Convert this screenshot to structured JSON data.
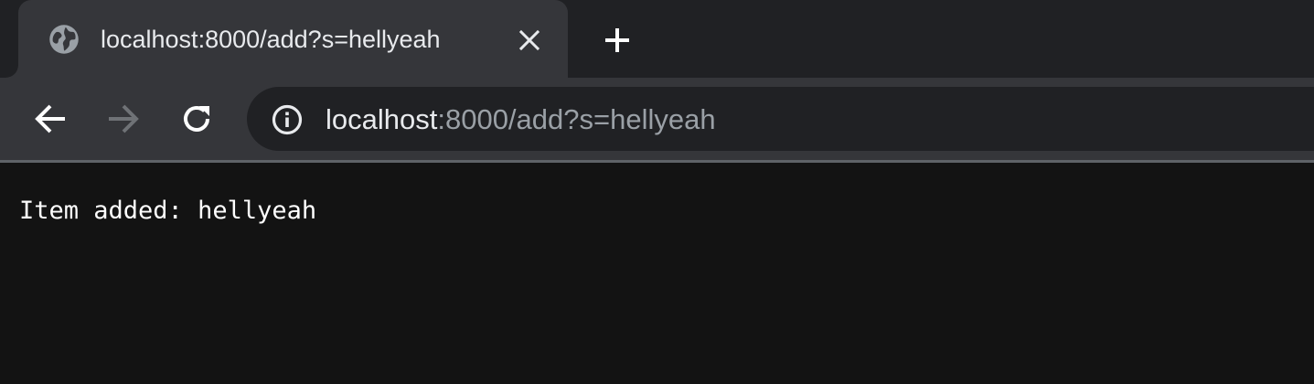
{
  "tab": {
    "title": "localhost:8000/add?s=hellyeah",
    "favicon": "globe-icon"
  },
  "toolbar": {
    "back_icon": "arrow-left-icon",
    "forward_icon": "arrow-right-icon",
    "reload_icon": "reload-icon",
    "new_tab_icon": "plus-icon",
    "close_tab_icon": "close-icon"
  },
  "address_bar": {
    "site_info_icon": "info-icon",
    "host": "localhost",
    "rest": ":8000/add?s=hellyeah"
  },
  "page": {
    "body_text": "Item added: hellyeah"
  },
  "colors": {
    "tabstrip_bg": "#202124",
    "active_tab_bg": "#35363a",
    "omnibox_bg": "#202124",
    "page_bg": "#131313",
    "text_primary": "#e8eaed",
    "text_muted": "#9aa0a6"
  }
}
